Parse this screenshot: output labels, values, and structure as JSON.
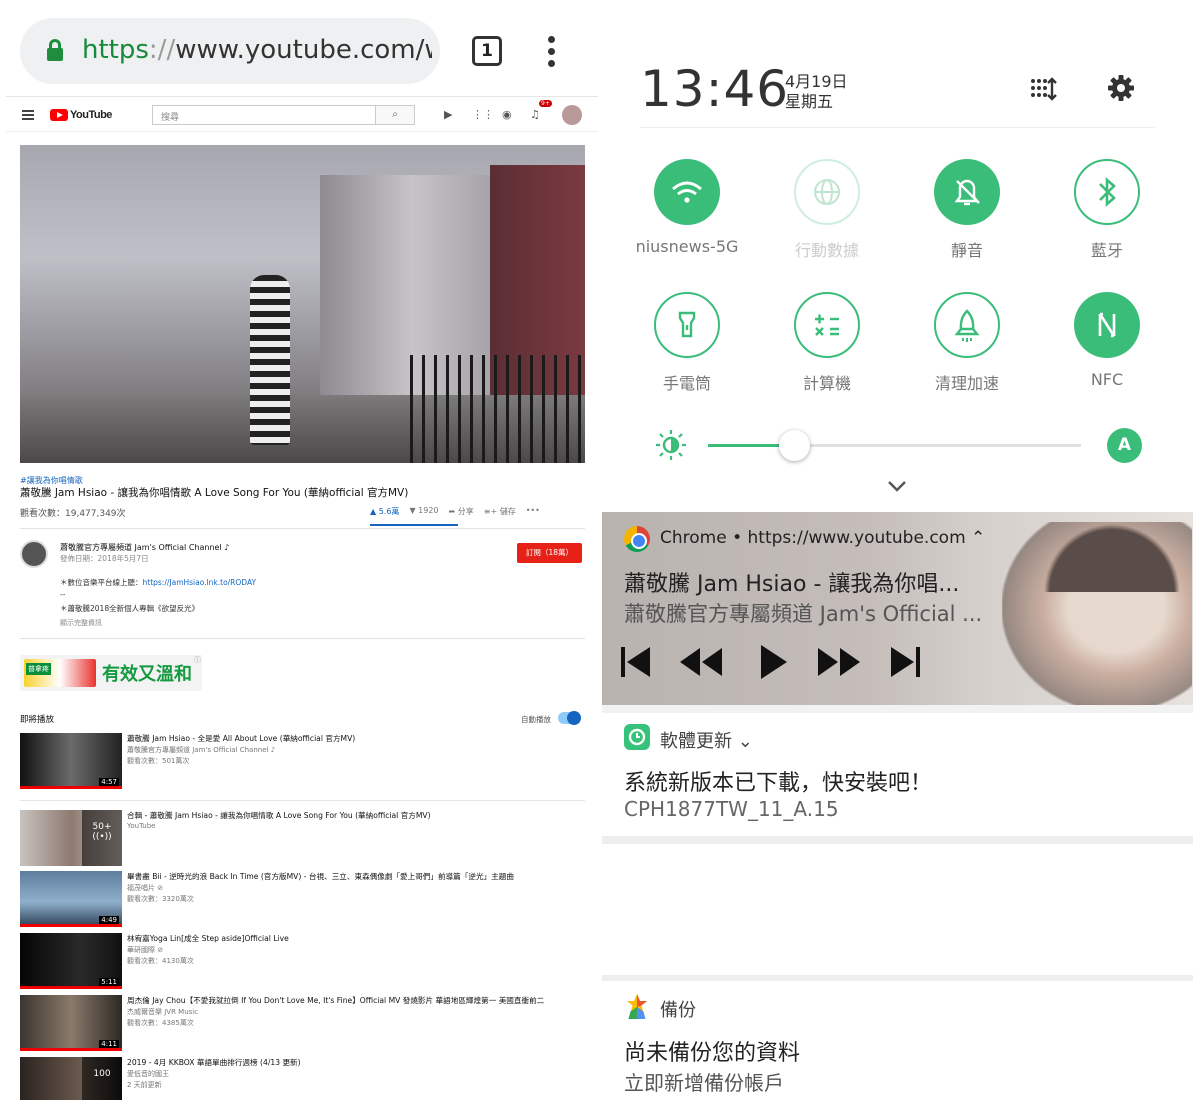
{
  "browser": {
    "url_scheme": "https",
    "url_sep": "://",
    "url_rest": "www.youtube.com/wa",
    "tab_count": "1"
  },
  "youtube": {
    "logo_text": "YouTube",
    "search_placeholder": "搜尋",
    "notification_badge": "9+",
    "hashtag": "#讓我為你唱情歌",
    "video_title": "蕭敬騰 Jam Hsiao - 讓我為你唱情歌 A Love Song For You (華納official 官方MV)",
    "views": "觀看次數：19,477,349次",
    "likes": "5.6萬",
    "dislikes": "1920",
    "share": "分享",
    "save": "儲存",
    "more": "•••",
    "channel_name": "蕭敬騰官方專屬頻道 Jam's Official Channel ♪",
    "publish_date": "發佈日期：2018年5月7日",
    "subscribe": "訂閱（18萬）",
    "desc_line1": "＊數位音樂平台線上聽：",
    "desc_link": "https://JamHsiao.lnk.to/RODAY",
    "desc_line2": "--",
    "desc_line3": "＊蕭敬騰2018全新個人專輯《欲望反光》",
    "show_more": "顯示完整資訊",
    "ad_brand": "普拿疼",
    "ad_text": "有效又溫和",
    "ad_info": "ⓘ",
    "up_next": "即將播放",
    "autoplay": "自動播放",
    "related": [
      {
        "title": "蕭敬騰 Jam Hsiao - 全是愛 All About Love (華納official 官方MV)",
        "channel": "蕭敬騰官方專屬頻道 Jam's Official Channel ♪",
        "views": "觀看次數：501萬次",
        "duration": "4:57"
      },
      {
        "title": "合輯 - 蕭敬騰 Jam Hsiao - 讓我為你唱情歌 A Love Song For You (華納official 官方MV)",
        "channel": "YouTube",
        "views": "",
        "duration": "",
        "count": "50+"
      },
      {
        "title": "畢書盡 Bii - 逆時光的浪 Back In Time (官方版MV) - 台視、三立、東森偶像劇「愛上哥們」前導篇「逆光」主題曲",
        "channel": "福茂唱片 ⊘",
        "views": "觀看次數：3320萬次",
        "duration": "4:49"
      },
      {
        "title": "林宥嘉Yoga Lin[成全 Step aside]Official Live",
        "channel": "華研國際 ⊘",
        "views": "觀看次數：4130萬次",
        "duration": "5:11"
      },
      {
        "title": "周杰倫 Jay Chou【不愛我就拉倒 If You Don't Love Me, It's Fine】Official MV 發燒影片 華語地區輝煌第一 美國直衝前二",
        "channel": "杰威爾音樂 JVR Music",
        "views": "觀看次數：4385萬次",
        "duration": "4:11"
      },
      {
        "title": "2019 - 4月 KKBOX 華語單曲排行週榜 (4/13 更新)",
        "channel": "愛低音的國王",
        "views": "2 天前更新",
        "duration": "",
        "count": "100"
      }
    ]
  },
  "shade": {
    "time": "13:46",
    "date": "4月19日",
    "weekday": "星期五",
    "tiles": [
      {
        "label": "niusnews-5G",
        "state": "on",
        "icon": "wifi-icon"
      },
      {
        "label": "行動數據",
        "state": "disabled",
        "icon": "globe-icon"
      },
      {
        "label": "靜音",
        "state": "on",
        "icon": "bell-off-icon"
      },
      {
        "label": "藍牙",
        "state": "off",
        "icon": "bluetooth-icon"
      },
      {
        "label": "手電筒",
        "state": "off",
        "icon": "flashlight-icon"
      },
      {
        "label": "計算機",
        "state": "off",
        "icon": "calculator-icon"
      },
      {
        "label": "清理加速",
        "state": "off",
        "icon": "rocket-icon"
      },
      {
        "label": "NFC",
        "state": "on",
        "icon": "nfc-icon"
      }
    ],
    "brightness_level": 0.23,
    "auto_brightness": "A",
    "accent": "#3bbd7a"
  },
  "media": {
    "app": "Chrome • https://www.youtube.com ⌃",
    "title": "蕭敬騰 Jam Hsiao - 讓我為你唱...",
    "subtitle": "蕭敬騰官方專屬頻道 Jam's Official ..."
  },
  "update_notif": {
    "app": "軟體更新 ⌄",
    "title": "系統新版本已下載，快安裝吧！",
    "subtitle": "CPH1877TW_11_A.15"
  },
  "backup_notif": {
    "app": "備份",
    "title": "尚未備份您的資料",
    "subtitle": "立即新增備份帳戶"
  }
}
